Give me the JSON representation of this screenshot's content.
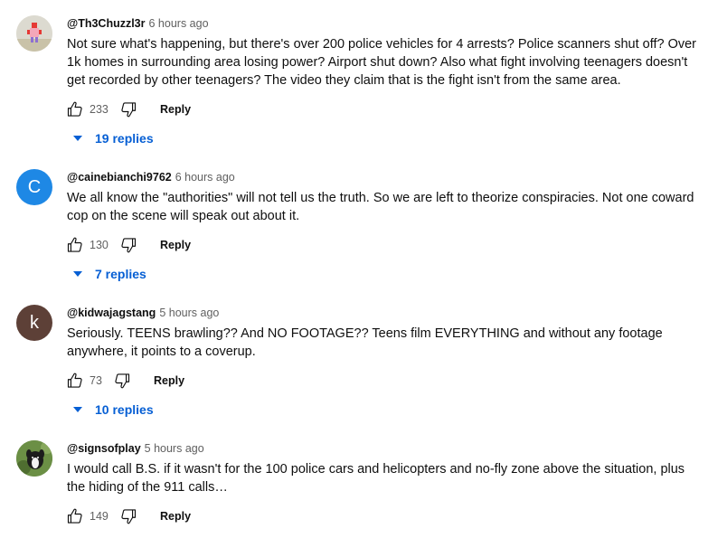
{
  "comments": [
    {
      "author": "@Th3Chuzzl3r",
      "time": "6 hours ago",
      "text": "Not sure what's happening, but there's over 200 police vehicles for 4 arrests? Police scanners shut off? Over 1k homes in surrounding area losing power? Airport shut down? Also what fight involving teenagers doesn't get recorded by other teenagers? The video they claim that is the fight isn't from the same area.",
      "likes": "233",
      "reply_label": "Reply",
      "replies_label": "19 replies",
      "avatar": "pixel-character-avatar"
    },
    {
      "author": "@cainebianchi9762",
      "time": "6 hours ago",
      "text": "We all know the \"authorities\" will not tell us the truth. So we are left to theorize conspiracies. Not one coward cop on the scene will speak out about it.",
      "likes": "130",
      "reply_label": "Reply",
      "replies_label": "7 replies",
      "avatar_letter": "C",
      "avatar_color": "#1e88e5"
    },
    {
      "author": "@kidwajagstang",
      "time": "5 hours ago",
      "text": "Seriously. TEENS brawling?? And NO FOOTAGE?? Teens film EVERYTHING and without any footage anywhere, it points to a coverup.",
      "likes": "73",
      "reply_label": "Reply",
      "replies_label": "10 replies",
      "avatar_letter": "k",
      "avatar_color": "#5d4037"
    },
    {
      "author": "@signsofplay",
      "time": "5 hours ago",
      "text": "I would call B.S. if it wasn't for the 100 police cars and helicopters and no-fly zone above the situation, plus the hiding of the 911 calls…",
      "likes": "149",
      "reply_label": "Reply",
      "avatar": "dog-photo-avatar"
    }
  ],
  "colors": {
    "link_blue": "#065fd4",
    "secondary_text": "#606060"
  }
}
